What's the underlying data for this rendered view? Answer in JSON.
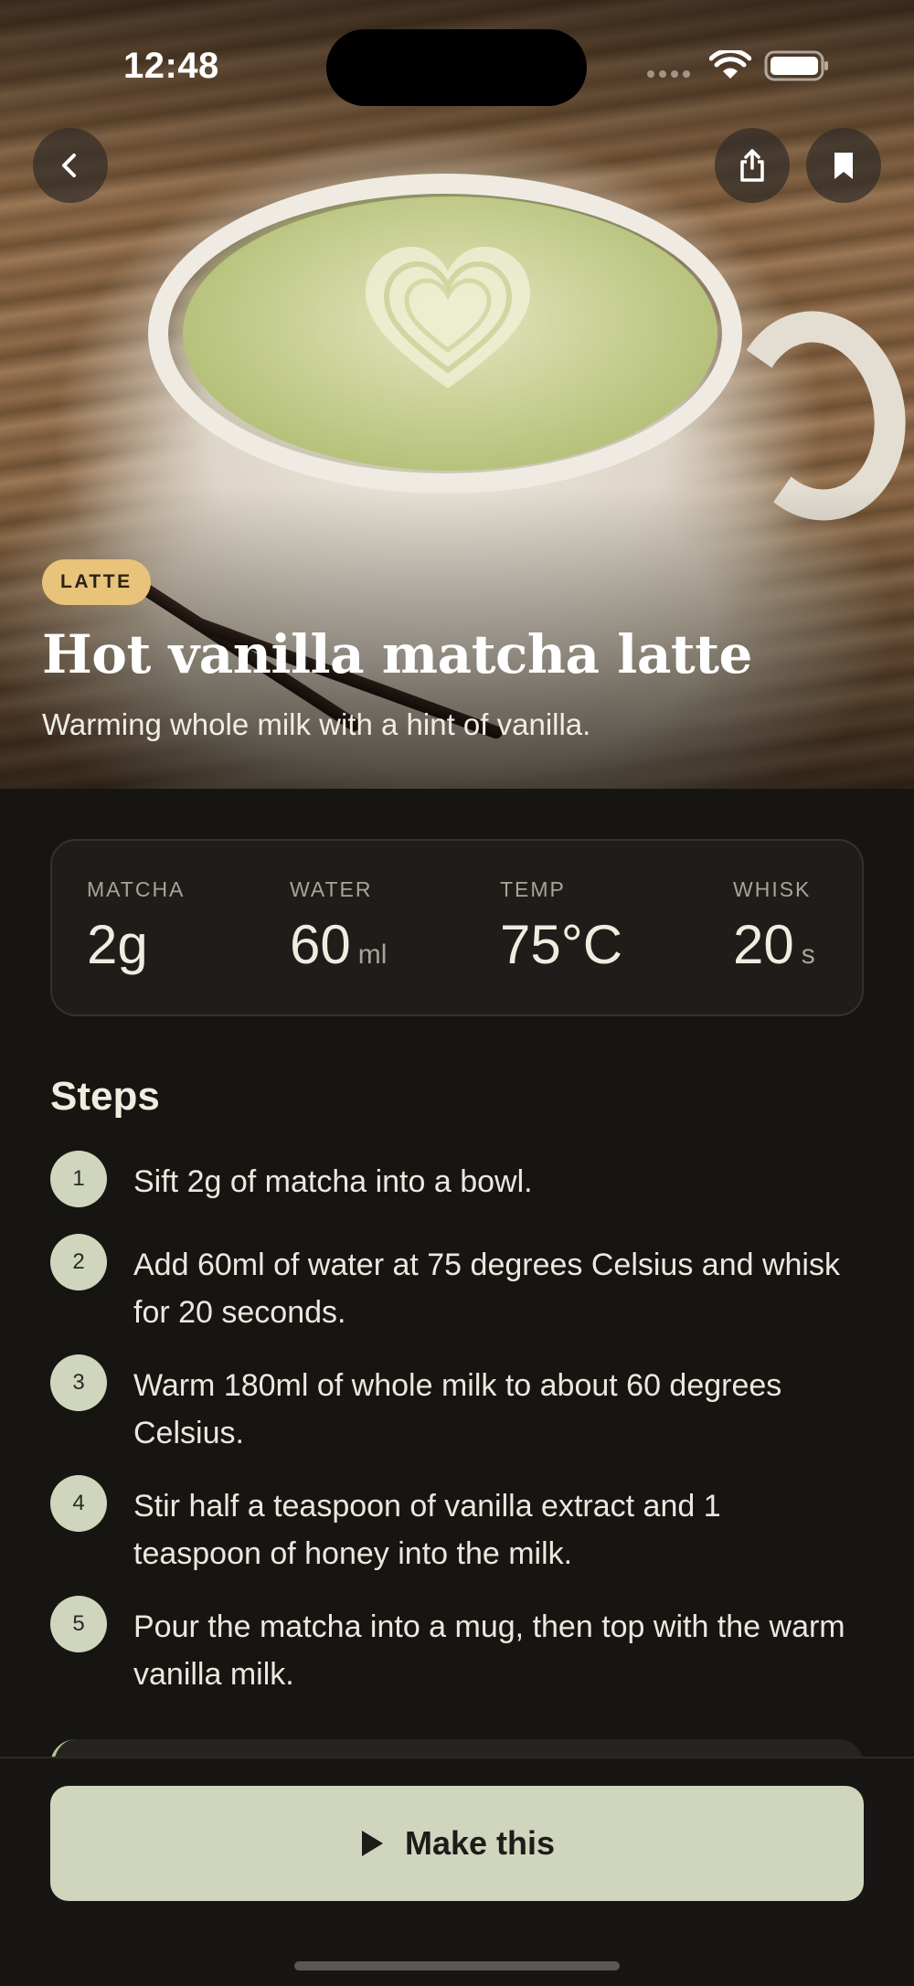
{
  "status_bar": {
    "time": "12:48"
  },
  "hero": {
    "tag": "LATTE",
    "title": "Hot vanilla matcha latte",
    "subtitle": "Warming whole milk with a hint of vanilla."
  },
  "header_buttons": {
    "back_icon": "chevron-left-icon",
    "share_icon": "share-icon",
    "bookmark_icon": "bookmark-icon"
  },
  "stats": [
    {
      "label": "MATCHA",
      "value": "2g",
      "unit": ""
    },
    {
      "label": "WATER",
      "value": "60",
      "unit": "ml"
    },
    {
      "label": "TEMP",
      "value": "75°C",
      "unit": ""
    },
    {
      "label": "WHISK",
      "value": "20",
      "unit": "s"
    }
  ],
  "steps": {
    "title": "Steps",
    "items": [
      {
        "number": "1",
        "text": "Sift 2g of matcha into a bowl."
      },
      {
        "number": "2",
        "text": "Add 60ml of water at 75 degrees Celsius and whisk for 20 seconds."
      },
      {
        "number": "3",
        "text": "Warm 180ml of whole milk to about 60 degrees Celsius."
      },
      {
        "number": "4",
        "text": "Stir half a teaspoon of vanilla extract and 1 teaspoon of honey into the milk."
      },
      {
        "number": "5",
        "text": "Pour the matcha into a mug, then top with the warm vanilla milk."
      }
    ]
  },
  "action": {
    "label": "Make this",
    "icon": "play-icon"
  },
  "colors": {
    "background": "#161512",
    "accent": "#cfd6bd",
    "tag": "#e9c37a"
  }
}
